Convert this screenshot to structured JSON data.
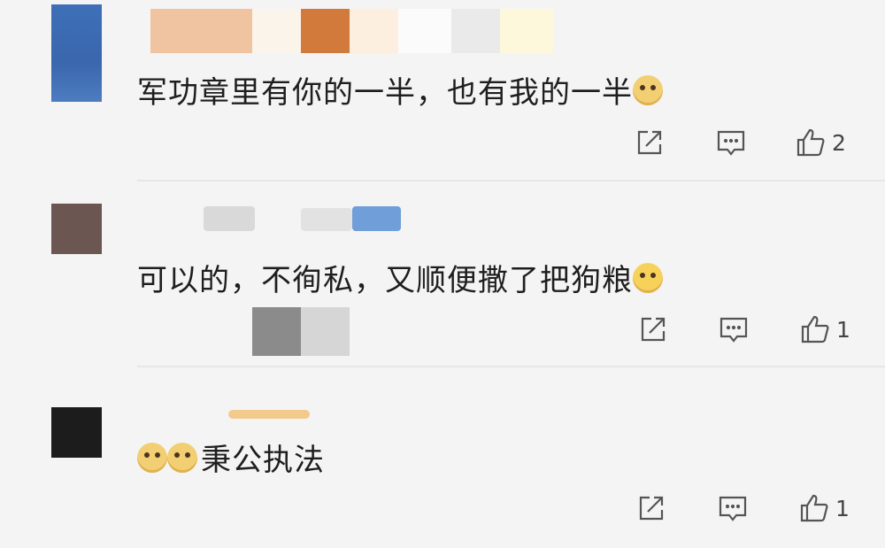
{
  "comments": [
    {
      "text": "军功章里有你的一半，也有我的一半",
      "emojis": [
        "doge-emoji"
      ],
      "actions": {
        "like_count": "2"
      }
    },
    {
      "text": "可以的，不徇私，又顺便撒了把狗粮",
      "emojis": [
        "shocked-emoji"
      ],
      "actions": {
        "like_count": "1"
      }
    },
    {
      "text": "秉公执法",
      "emojis": [
        "doge-emoji",
        "doge-emoji"
      ],
      "actions": {
        "like_count": "1"
      }
    }
  ],
  "icons": {
    "share": "share-icon",
    "reply": "reply-icon",
    "like": "thumbs-up-icon"
  },
  "colors": {
    "background": "#f4f4f4",
    "text": "#1e1e1e",
    "icon": "#555555"
  }
}
